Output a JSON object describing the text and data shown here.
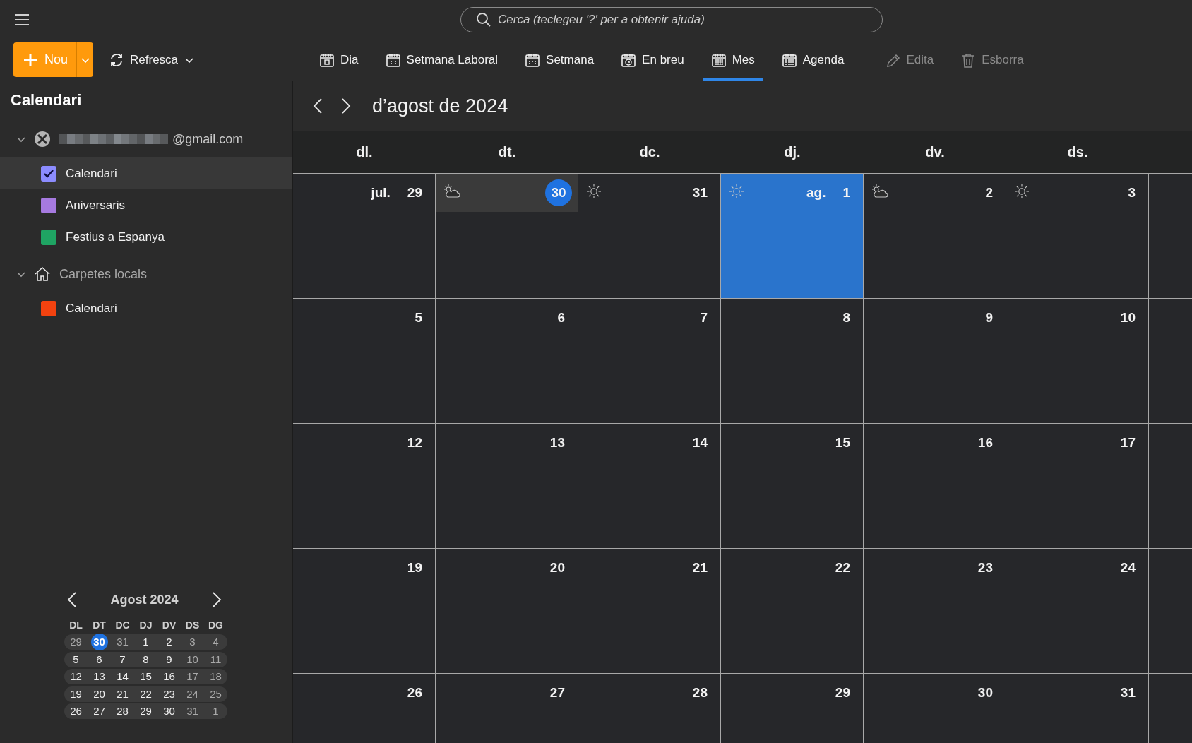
{
  "toolbar": {
    "search": {
      "placeholder": "Cerca (teclegeu '?' per a obtenir ajuda)"
    },
    "new_button": "Nou",
    "refresh_button": "Refresca",
    "views": [
      {
        "label": "Dia",
        "kind": "day",
        "selected": false
      },
      {
        "label": "Setmana Laboral",
        "kind": "work-week",
        "selected": false
      },
      {
        "label": "Setmana",
        "kind": "week",
        "selected": false
      },
      {
        "label": "En breu",
        "kind": "upcoming",
        "selected": false
      },
      {
        "label": "Mes",
        "kind": "month",
        "selected": true
      },
      {
        "label": "Agenda",
        "kind": "agenda",
        "selected": false
      }
    ],
    "actions": [
      {
        "label": "Edita",
        "kind": "edit",
        "disabled": true
      },
      {
        "label": "Esborra",
        "kind": "delete",
        "disabled": true
      }
    ]
  },
  "sidebar": {
    "title": "Calendari",
    "accounts": [
      {
        "label": "@gmail.com",
        "kind": "email",
        "expanded": true,
        "calendars": [
          {
            "label": "Calendari",
            "color": "#8c8cff",
            "checked": true,
            "selected": true
          },
          {
            "label": "Aniversaris",
            "color": "#a67ae0",
            "checked": false,
            "selected": false
          },
          {
            "label": "Festius a Espanya",
            "color": "#1fa463",
            "checked": false,
            "selected": false
          }
        ]
      },
      {
        "label": "Carpetes locals",
        "kind": "local",
        "expanded": true,
        "calendars": [
          {
            "label": "Calendari",
            "color": "#f2420f",
            "checked": false,
            "selected": false
          }
        ]
      }
    ],
    "mini_calendar": {
      "title": "Agost 2024",
      "weekdays": [
        "DL",
        "DT",
        "DC",
        "DJ",
        "DV",
        "DS",
        "DG"
      ],
      "weeks": [
        [
          {
            "day": "29",
            "dim": true,
            "today": false
          },
          {
            "day": "30",
            "dim": false,
            "today": true
          },
          {
            "day": "31",
            "dim": true,
            "today": false
          },
          {
            "day": "1",
            "dim": false,
            "today": false
          },
          {
            "day": "2",
            "dim": false,
            "today": false
          },
          {
            "day": "3",
            "dim": true,
            "today": false
          },
          {
            "day": "4",
            "dim": true,
            "today": false
          }
        ],
        [
          {
            "day": "5",
            "dim": false,
            "today": false
          },
          {
            "day": "6",
            "dim": false,
            "today": false
          },
          {
            "day": "7",
            "dim": false,
            "today": false
          },
          {
            "day": "8",
            "dim": false,
            "today": false
          },
          {
            "day": "9",
            "dim": false,
            "today": false
          },
          {
            "day": "10",
            "dim": true,
            "today": false
          },
          {
            "day": "11",
            "dim": true,
            "today": false
          }
        ],
        [
          {
            "day": "12",
            "dim": false,
            "today": false
          },
          {
            "day": "13",
            "dim": false,
            "today": false
          },
          {
            "day": "14",
            "dim": false,
            "today": false
          },
          {
            "day": "15",
            "dim": false,
            "today": false
          },
          {
            "day": "16",
            "dim": false,
            "today": false
          },
          {
            "day": "17",
            "dim": true,
            "today": false
          },
          {
            "day": "18",
            "dim": true,
            "today": false
          }
        ],
        [
          {
            "day": "19",
            "dim": false,
            "today": false
          },
          {
            "day": "20",
            "dim": false,
            "today": false
          },
          {
            "day": "21",
            "dim": false,
            "today": false
          },
          {
            "day": "22",
            "dim": false,
            "today": false
          },
          {
            "day": "23",
            "dim": false,
            "today": false
          },
          {
            "day": "24",
            "dim": true,
            "today": false
          },
          {
            "day": "25",
            "dim": true,
            "today": false
          }
        ],
        [
          {
            "day": "26",
            "dim": false,
            "today": false
          },
          {
            "day": "27",
            "dim": false,
            "today": false
          },
          {
            "day": "28",
            "dim": false,
            "today": false
          },
          {
            "day": "29",
            "dim": false,
            "today": false
          },
          {
            "day": "30",
            "dim": false,
            "today": false
          },
          {
            "day": "31",
            "dim": true,
            "today": false
          },
          {
            "day": "1",
            "dim": true,
            "today": false
          }
        ]
      ]
    }
  },
  "month_view": {
    "title": "d’agost de 2024",
    "weekdays": [
      "dl.",
      "dt.",
      "dc.",
      "dj.",
      "dv.",
      "ds."
    ],
    "weeks": [
      [
        {
          "day": "29",
          "month": "jul.",
          "today": false,
          "selected": false
        },
        {
          "day": "30",
          "kind": "partly-cloudy",
          "today": true,
          "selected": false
        },
        {
          "day": "31",
          "kind": "sunny",
          "today": false,
          "selected": false
        },
        {
          "day": "1",
          "month": "ag.",
          "kind": "sunny",
          "today": false,
          "selected": true
        },
        {
          "day": "2",
          "kind": "partly-cloudy",
          "today": false,
          "selected": false
        },
        {
          "day": "3",
          "kind": "sunny",
          "today": false,
          "selected": false
        }
      ],
      [
        {
          "day": "5",
          "today": false,
          "selected": false
        },
        {
          "day": "6",
          "today": false,
          "selected": false
        },
        {
          "day": "7",
          "today": false,
          "selected": false
        },
        {
          "day": "8",
          "today": false,
          "selected": false
        },
        {
          "day": "9",
          "today": false,
          "selected": false
        },
        {
          "day": "10",
          "today": false,
          "selected": false
        }
      ],
      [
        {
          "day": "12",
          "today": false,
          "selected": false
        },
        {
          "day": "13",
          "today": false,
          "selected": false
        },
        {
          "day": "14",
          "today": false,
          "selected": false
        },
        {
          "day": "15",
          "today": false,
          "selected": false
        },
        {
          "day": "16",
          "today": false,
          "selected": false
        },
        {
          "day": "17",
          "today": false,
          "selected": false
        }
      ],
      [
        {
          "day": "19",
          "today": false,
          "selected": false
        },
        {
          "day": "20",
          "today": false,
          "selected": false
        },
        {
          "day": "21",
          "today": false,
          "selected": false
        },
        {
          "day": "22",
          "today": false,
          "selected": false
        },
        {
          "day": "23",
          "today": false,
          "selected": false
        },
        {
          "day": "24",
          "today": false,
          "selected": false
        }
      ],
      [
        {
          "day": "26",
          "today": false,
          "selected": false
        },
        {
          "day": "27",
          "today": false,
          "selected": false
        },
        {
          "day": "28",
          "today": false,
          "selected": false
        },
        {
          "day": "29",
          "today": false,
          "selected": false
        },
        {
          "day": "30",
          "today": false,
          "selected": false
        },
        {
          "day": "31",
          "today": false,
          "selected": false
        }
      ]
    ]
  }
}
